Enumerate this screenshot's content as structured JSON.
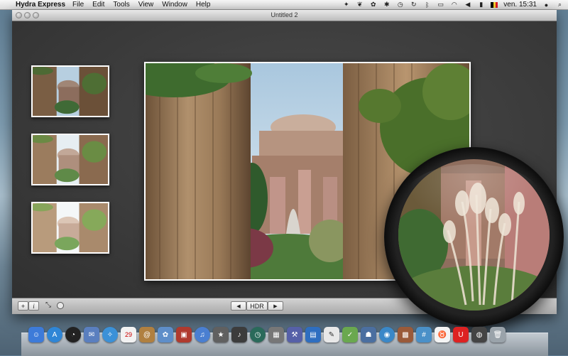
{
  "menubar": {
    "apple_glyph": "",
    "app_name": "Hydra Express",
    "menus": [
      "File",
      "Edit",
      "Tools",
      "View",
      "Window",
      "Help"
    ],
    "clock": "ven. 15:31"
  },
  "window": {
    "title": "Untitled 2"
  },
  "toolbar": {
    "add_label": "+",
    "info_label": "i",
    "resize_glyph": "⤡",
    "prev_label": "◀",
    "hdr_label": "HDR",
    "next_label": "▶"
  },
  "thumbnails": [
    {
      "name": "bracket-1"
    },
    {
      "name": "bracket-2"
    },
    {
      "name": "bracket-3"
    }
  ],
  "dock": {
    "icons": [
      "finder-icon",
      "appstore-icon",
      "dashboard-icon",
      "mail-stamp-icon",
      "safari-icon",
      "ical-icon",
      "address-book-icon",
      "iphoto-icon",
      "photo-booth-icon",
      "itunes-icon",
      "imovie-icon",
      "garageband-icon",
      "time-machine-icon",
      "preview-icon",
      "xcode-icon",
      "dictionary-icon",
      "textedit-icon",
      "script-icon",
      "hydra-icon",
      "network-icon",
      "photo-icon",
      "calculator-icon",
      "cow-icon",
      "magnet-icon",
      "camera-icon",
      "trash-icon"
    ]
  }
}
